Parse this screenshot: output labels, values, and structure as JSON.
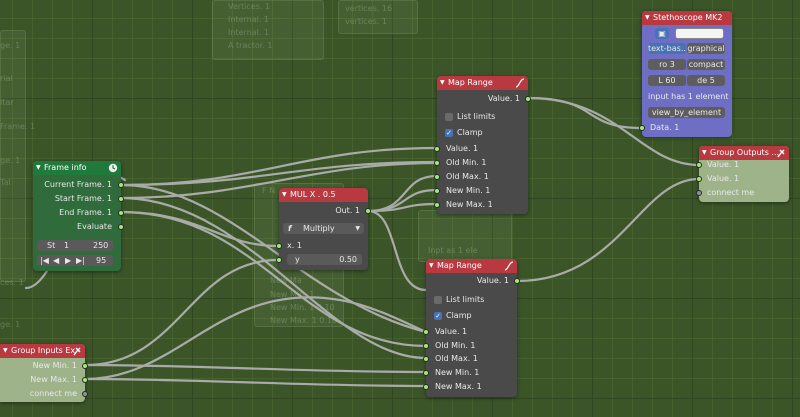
{
  "background_labels": {
    "top": [
      "Vertices. 1",
      "Internal. 1",
      "Internal. 1",
      "A tractor. 1"
    ],
    "top_right": [
      "vertices. 16",
      "vertices. 1"
    ],
    "left": [
      "ge. 1",
      "rial",
      "ltar",
      "Frame. 1",
      "ces. 1",
      "ge. 1",
      "Tal",
      "ge. 1"
    ],
    "behind_mul": [
      "F N",
      "New Min. 1 0.10",
      "New Max. 1 0.10",
      "New Min. 1",
      "New Ma"
    ],
    "behind_map": [
      "Inpt as 1 ele"
    ]
  },
  "frame_info": {
    "title": "Frame info",
    "outputs": [
      "Current Frame. 1",
      "Start Frame. 1",
      "End Frame. 1",
      "Evaluate"
    ],
    "start_label": "St",
    "start_value": "1",
    "end_value": "250",
    "playback_frame": "95",
    "playback_icons": [
      "jump-start-icon",
      "step-back-icon",
      "play-icon",
      "step-forward-icon"
    ]
  },
  "mul_node": {
    "title": "MUL X . 0.5",
    "output": "Out. 1",
    "operation": "Multiply",
    "input_x": "x. 1",
    "input_y_label": "y",
    "input_y_value": "0.50"
  },
  "map_range_top": {
    "title": "Map Range",
    "output": "Value. 1",
    "list_limits": "List limits",
    "clamp": "Clamp",
    "inputs": [
      "Value. 1",
      "Old Min. 1",
      "Old Max. 1",
      "New Min. 1",
      "New Max. 1"
    ]
  },
  "map_range_bottom": {
    "title": "Map Range",
    "output": "Value. 1",
    "list_limits": "List limits",
    "clamp": "Clamp",
    "inputs": [
      "Value. 1",
      "Old Min. 1",
      "Old Max. 1",
      "New Min. 1",
      "New Max. 1"
    ]
  },
  "stethoscope": {
    "title": "Stethoscope MK2",
    "mode_text": "text-bas...",
    "mode_graphical": "graphical",
    "ro_label": "ro",
    "ro_value": "3",
    "compact": "compact",
    "l_label": "L",
    "l_value": "60",
    "de_label": "de",
    "de_value": "5",
    "status": "input has 1 element",
    "view_button": "view_by_element",
    "input": "Data. 1"
  },
  "group_outputs": {
    "title": "Group Outputs ...",
    "inputs": [
      "Value. 1",
      "Value. 1",
      "connect me"
    ]
  },
  "group_inputs": {
    "title": "Group Inputs Ex",
    "outputs": [
      "New Min. 1",
      "New Max. 1",
      "connect me"
    ]
  },
  "colors": {
    "background": "#3b5529",
    "node_body": "#4a4a4a",
    "header_red": "#b8393f",
    "header_green": "#1f7a3c",
    "stethoscope_body": "#6e6fc4",
    "group_body": "#9fb38a",
    "socket_green": "#a1e87a",
    "link": "#b3b3b3",
    "accent_blue": "#4772b3"
  }
}
